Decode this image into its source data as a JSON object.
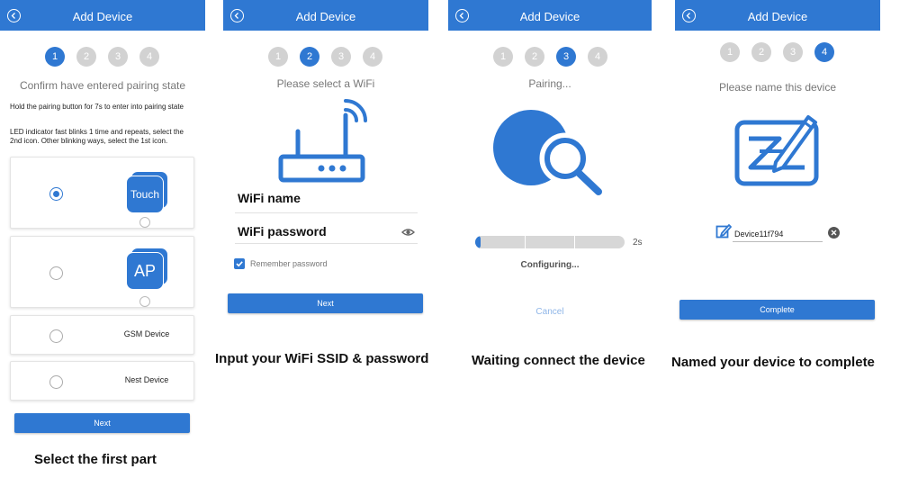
{
  "screen1": {
    "title": "Add Device",
    "steps": [
      "1",
      "2",
      "3",
      "4"
    ],
    "subtitle": "Confirm have entered pairing state",
    "instructions": [
      "Hold the pairing button for 7s to enter into pairing state",
      "LED indicator fast blinks 1 time and repeats, select the 2nd icon. Other blinking ways, select the 1st icon."
    ],
    "options": [
      {
        "label": "Touch",
        "selected": true
      },
      {
        "label": "AP",
        "selected": false
      },
      {
        "label": "GSM Device",
        "selected": false
      },
      {
        "label": "Nest Device",
        "selected": false
      }
    ],
    "next_label": "Next",
    "caption": "Select the first part"
  },
  "screen2": {
    "title": "Add Device",
    "steps": [
      "1",
      "2",
      "3",
      "4"
    ],
    "subtitle": "Please select a WiFi",
    "wifi_name_label": "WiFi name",
    "wifi_password_label": "WiFi password",
    "remember_label": "Remember password",
    "remember_checked": true,
    "next_label": "Next",
    "caption": "Input your WiFi SSID & password"
  },
  "screen3": {
    "title": "Add Device",
    "steps": [
      "1",
      "2",
      "3",
      "4"
    ],
    "subtitle": "Pairing...",
    "progress_fraction": 0.03,
    "progress_time": "2s",
    "status": "Configuring...",
    "cancel_label": "Cancel",
    "caption": "Waiting connect the device"
  },
  "screen4": {
    "title": "Add Device",
    "steps": [
      "1",
      "2",
      "3",
      "4"
    ],
    "subtitle": "Please name this device",
    "device_name": "Device11f794",
    "complete_label": "Complete",
    "caption": "Named your device to complete"
  },
  "colors": {
    "accent": "#2f78d2",
    "inactive_step": "#d2d2d2",
    "muted_text": "#777777"
  },
  "icons": [
    "back-arrow-icon",
    "router-wifi-icon",
    "search-magnifier-icon",
    "rename-pen-icon",
    "edit-icon",
    "eye-icon",
    "clear-icon",
    "checkbox-icon"
  ]
}
